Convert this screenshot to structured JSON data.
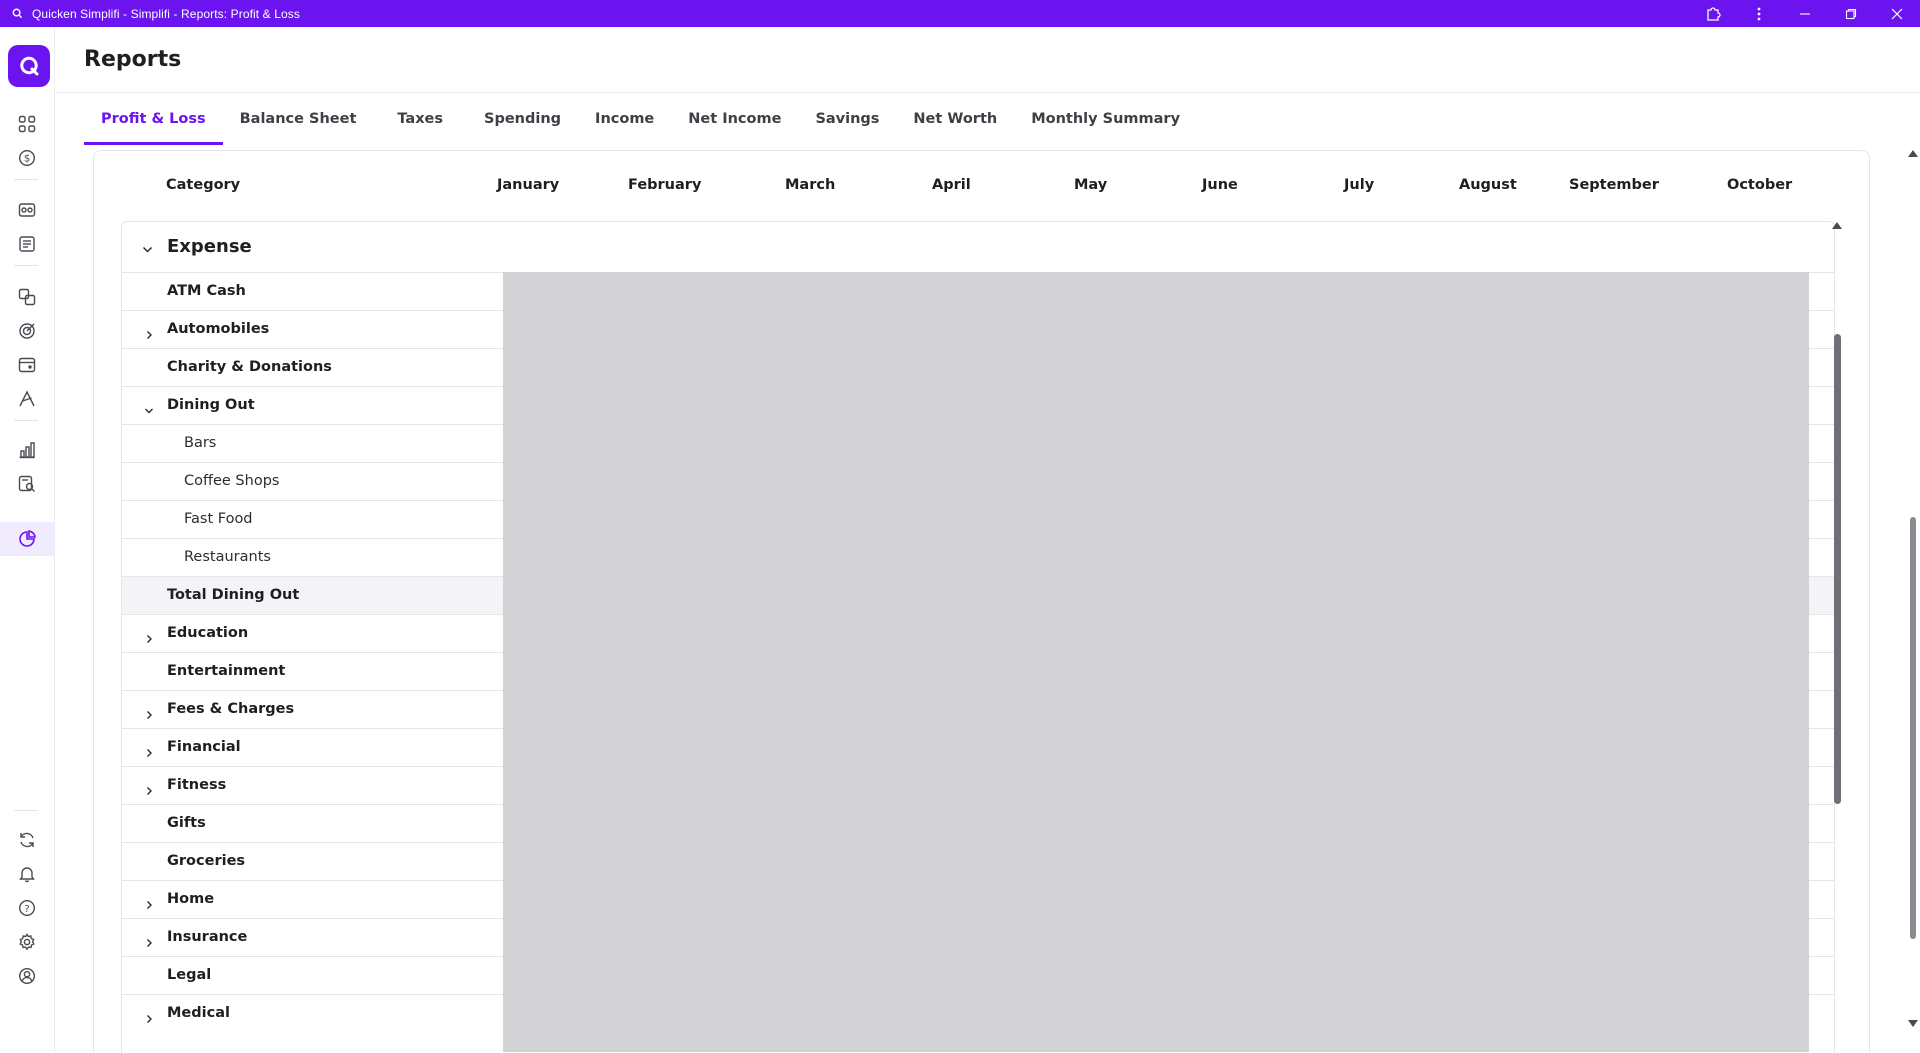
{
  "window": {
    "title": "Quicken Simplifi - Simplifi - Reports: Profit & Loss"
  },
  "page": {
    "title": "Reports"
  },
  "tabs": [
    {
      "label": "Profit & Loss",
      "active": true
    },
    {
      "label": "Balance Sheet",
      "active": false
    },
    {
      "label": "Taxes",
      "active": false
    },
    {
      "label": "Spending",
      "active": false
    },
    {
      "label": "Income",
      "active": false
    },
    {
      "label": "Net Income",
      "active": false
    },
    {
      "label": "Savings",
      "active": false
    },
    {
      "label": "Net Worth",
      "active": false
    },
    {
      "label": "Monthly Summary",
      "active": false
    }
  ],
  "columns": [
    "Category",
    "January",
    "February",
    "March",
    "April",
    "May",
    "June",
    "July",
    "August",
    "September",
    "October"
  ],
  "section": {
    "label": "Expense",
    "expanded": true
  },
  "rows": [
    {
      "label": "ATM Cash",
      "kind": "category",
      "expander": "none"
    },
    {
      "label": "Automobiles",
      "kind": "category",
      "expander": "collapsed"
    },
    {
      "label": "Charity & Donations",
      "kind": "category",
      "expander": "none"
    },
    {
      "label": "Dining Out",
      "kind": "category",
      "expander": "expanded"
    },
    {
      "label": "Bars",
      "kind": "subcategory",
      "expander": "none"
    },
    {
      "label": "Coffee Shops",
      "kind": "subcategory",
      "expander": "none"
    },
    {
      "label": "Fast Food",
      "kind": "subcategory",
      "expander": "none"
    },
    {
      "label": "Restaurants",
      "kind": "subcategory",
      "expander": "none"
    },
    {
      "label": "Total Dining Out",
      "kind": "total",
      "expander": "none"
    },
    {
      "label": "Education",
      "kind": "category",
      "expander": "collapsed"
    },
    {
      "label": "Entertainment",
      "kind": "category",
      "expander": "none"
    },
    {
      "label": "Fees & Charges",
      "kind": "category",
      "expander": "collapsed"
    },
    {
      "label": "Financial",
      "kind": "category",
      "expander": "collapsed"
    },
    {
      "label": "Fitness",
      "kind": "category",
      "expander": "collapsed"
    },
    {
      "label": "Gifts",
      "kind": "category",
      "expander": "none"
    },
    {
      "label": "Groceries",
      "kind": "category",
      "expander": "none"
    },
    {
      "label": "Home",
      "kind": "category",
      "expander": "collapsed"
    },
    {
      "label": "Insurance",
      "kind": "category",
      "expander": "collapsed"
    },
    {
      "label": "Legal",
      "kind": "category",
      "expander": "none"
    },
    {
      "label": "Medical",
      "kind": "category",
      "expander": "collapsed"
    }
  ],
  "sidebar": {
    "items": [
      {
        "icon": "dashboard-icon"
      },
      {
        "icon": "money-icon"
      },
      {
        "icon": "accounts-icon"
      },
      {
        "icon": "transactions-icon"
      },
      {
        "icon": "bills-icon"
      },
      {
        "icon": "planning-icon"
      },
      {
        "icon": "calendar-icon"
      },
      {
        "icon": "investments-icon"
      },
      {
        "icon": "chart-icon"
      },
      {
        "icon": "search-report-icon"
      },
      {
        "icon": "reports-pie-icon",
        "active": true
      },
      {
        "icon": "sync-icon"
      },
      {
        "icon": "notifications-icon"
      },
      {
        "icon": "help-icon"
      },
      {
        "icon": "settings-icon"
      },
      {
        "icon": "profile-icon"
      }
    ]
  },
  "colors": {
    "brand": "#6b14f0",
    "overlay": "#d3d3d6",
    "text": "#1f1f23"
  }
}
